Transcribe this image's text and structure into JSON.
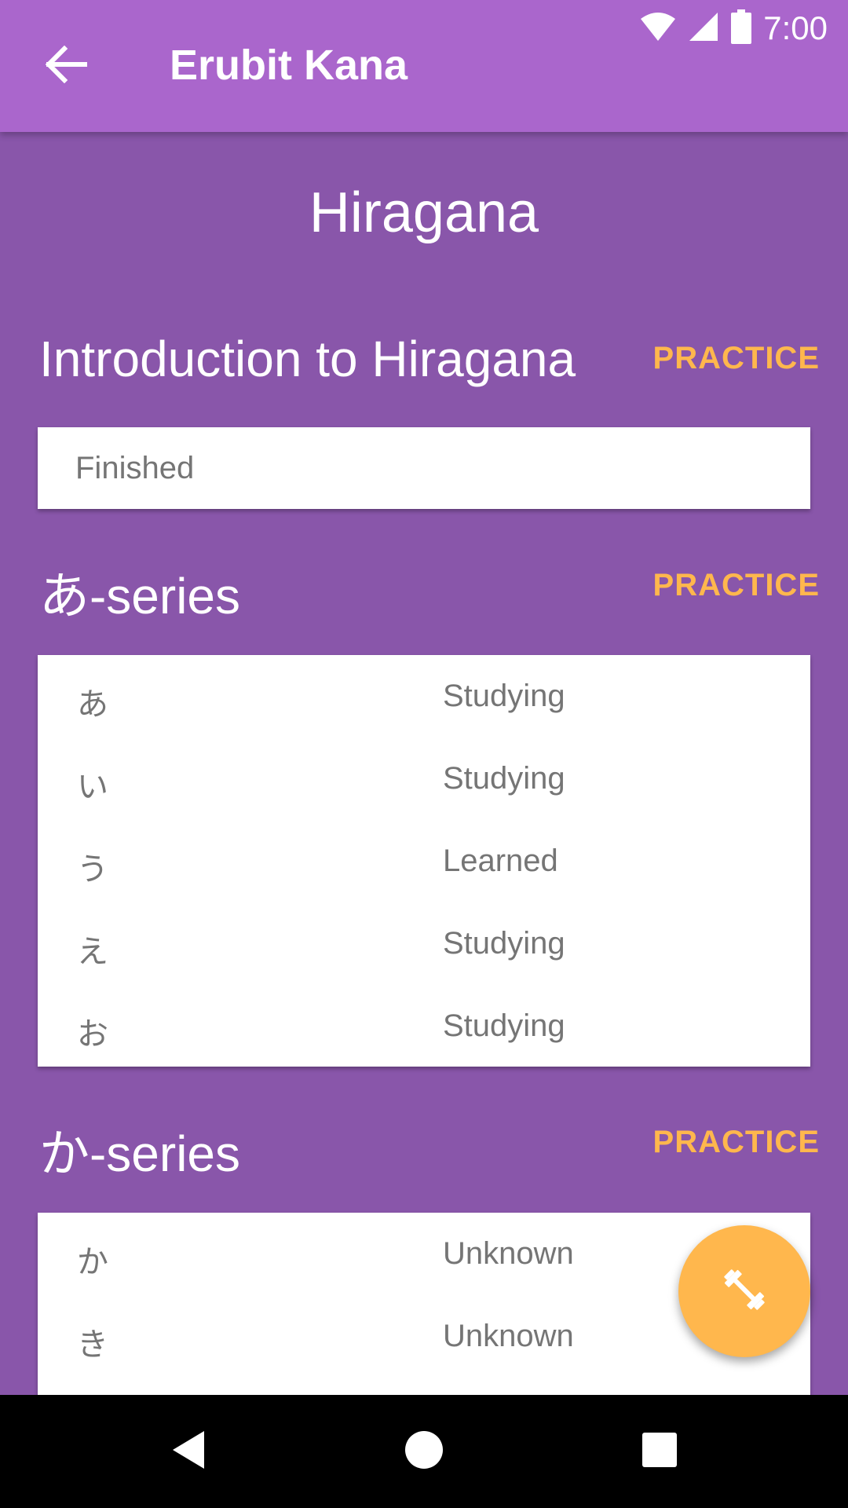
{
  "status_bar": {
    "time": "7:00",
    "icons": [
      "wifi-icon",
      "signal-icon",
      "battery-icon"
    ]
  },
  "app_bar": {
    "title": "Erubit Kana",
    "back_icon": "arrow-left-icon"
  },
  "page": {
    "heading": "Hiragana"
  },
  "sections": [
    {
      "title": "Introduction to Hiragana",
      "action_label": "PRACTICE",
      "summary": "Finished"
    },
    {
      "title": "あ-series",
      "action_label": "PRACTICE",
      "rows": [
        {
          "kana": "あ",
          "status": "Studying"
        },
        {
          "kana": "い",
          "status": "Studying"
        },
        {
          "kana": "う",
          "status": "Learned"
        },
        {
          "kana": "え",
          "status": "Studying"
        },
        {
          "kana": "お",
          "status": "Studying"
        }
      ]
    },
    {
      "title": "か-series",
      "action_label": "PRACTICE",
      "rows": [
        {
          "kana": "か",
          "status": "Unknown"
        },
        {
          "kana": "き",
          "status": "Unknown"
        }
      ]
    }
  ],
  "fab": {
    "icon": "dumbbell-icon"
  },
  "nav_bar": {
    "icons": [
      "back-triangle-icon",
      "home-circle-icon",
      "recents-square-icon"
    ]
  },
  "colors": {
    "app_bar": "#AA66CC",
    "background": "#8956AA",
    "accent": "#FFB74D",
    "card": "#FFFFFF",
    "row_text": "#757575"
  }
}
